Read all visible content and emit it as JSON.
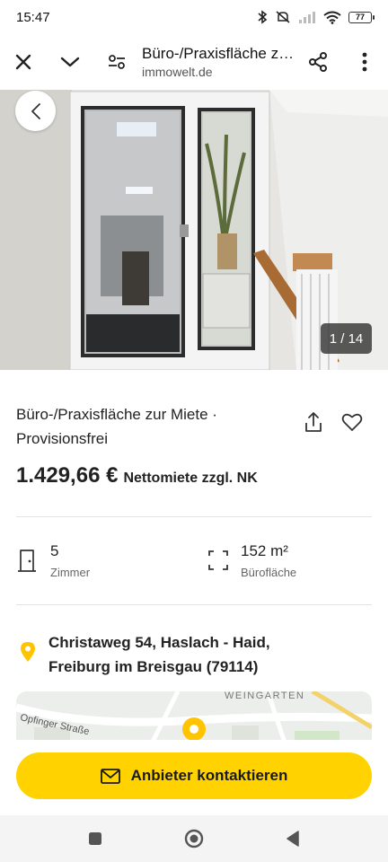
{
  "status_bar": {
    "time": "15:47",
    "battery": "77"
  },
  "toolbar": {
    "title": "Büro-/Praxisfläche zur Miete · Provisionsfrei",
    "url": "immowelt.de"
  },
  "gallery": {
    "counter": "1 / 14"
  },
  "listing": {
    "title_line1": "Büro-/Praxisfläche zur Miete  ·",
    "title_line2": "Provisionsfrei",
    "price": "1.429,66 €",
    "price_note": "Nettomiete zzgl. NK"
  },
  "features": [
    {
      "value": "5",
      "label": "Zimmer",
      "icon": "door-icon"
    },
    {
      "value": "152 m²",
      "label": "Bürofläche",
      "icon": "area-icon"
    }
  ],
  "address": {
    "line1": "Christaweg 54, Haslach - Haid,",
    "line2": "Freiburg im Breisgau (79114)"
  },
  "map": {
    "street_label": "Opfinger Straße",
    "district_label": "WEINGARTEN"
  },
  "cta": {
    "label": "Anbieter kontaktieren"
  },
  "colors": {
    "accent": "#ffd200",
    "pin": "#ffc400"
  }
}
